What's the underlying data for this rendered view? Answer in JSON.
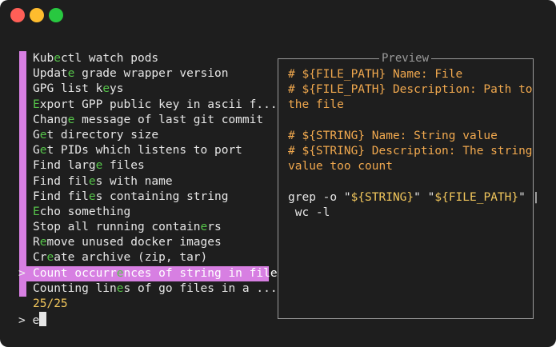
{
  "window": {
    "buttons": [
      "close",
      "minimize",
      "zoom"
    ],
    "colors": {
      "background": "#1e1e1e",
      "accent": "#d77fe2",
      "match": "#56c44a",
      "count": "#f2c75c",
      "comment": "#f0a84e"
    }
  },
  "list": {
    "items": [
      {
        "pre": "Kub",
        "hl": "e",
        "post": "ctl watch pods"
      },
      {
        "pre": "Updat",
        "hl": "e",
        "post": " grade wrapper version"
      },
      {
        "pre": "GPG list k",
        "hl": "e",
        "post": "ys"
      },
      {
        "pre": "",
        "hl": "E",
        "post": "xport GPP public key in ascii f..."
      },
      {
        "pre": "Chang",
        "hl": "e",
        "post": " message of last git commit"
      },
      {
        "pre": "G",
        "hl": "e",
        "post": "t directory size"
      },
      {
        "pre": "G",
        "hl": "e",
        "post": "t PIDs which listens to port"
      },
      {
        "pre": "Find larg",
        "hl": "e",
        "post": " files"
      },
      {
        "pre": "Find fil",
        "hl": "e",
        "post": "s with name"
      },
      {
        "pre": "Find fil",
        "hl": "e",
        "post": "s containing string"
      },
      {
        "pre": "",
        "hl": "E",
        "post": "cho something"
      },
      {
        "pre": "Stop all running contain",
        "hl": "e",
        "post": "rs"
      },
      {
        "pre": "R",
        "hl": "e",
        "post": "move unused docker images"
      },
      {
        "pre": "Cr",
        "hl": "e",
        "post": "ate archive (zip, tar)"
      },
      {
        "pre": "Count occurr",
        "hl": "e",
        "post": "nces of string in file",
        "selected": true
      },
      {
        "pre": "Counting lin",
        "hl": "e",
        "post": "s of go files in a ..."
      }
    ],
    "pointer": ">",
    "count": "25/25"
  },
  "prompt": {
    "symbol": ">",
    "query": "e"
  },
  "preview": {
    "title": "Preview",
    "lines": [
      {
        "type": "comment",
        "text": "# ${FILE_PATH} Name: File"
      },
      {
        "type": "comment",
        "text": "# ${FILE_PATH} Description: Path to"
      },
      {
        "type": "comment",
        "text": "the file"
      },
      {
        "type": "blank",
        "text": ""
      },
      {
        "type": "comment",
        "text": "# ${STRING} Name: String value"
      },
      {
        "type": "comment",
        "text": "# ${STRING} Description: The string"
      },
      {
        "type": "comment",
        "text": "value too count"
      },
      {
        "type": "blank",
        "text": ""
      },
      {
        "type": "code",
        "segments": [
          {
            "t": "grep -o \"",
            "v": false
          },
          {
            "t": "${STRING}",
            "v": true
          },
          {
            "t": "\" \"",
            "v": false
          },
          {
            "t": "${FILE_PATH}",
            "v": true
          },
          {
            "t": "\" |",
            "v": false
          }
        ]
      },
      {
        "type": "code",
        "segments": [
          {
            "t": " wc -l",
            "v": false
          }
        ]
      }
    ]
  }
}
